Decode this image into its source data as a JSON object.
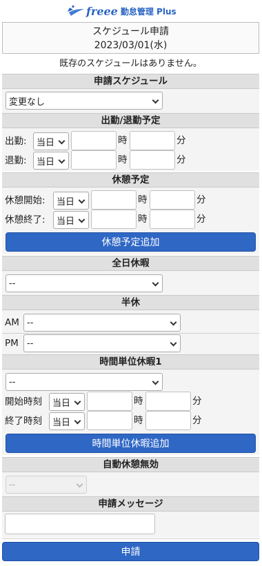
{
  "header": {
    "brand": "freee",
    "product": "勤怠管理 Plus",
    "title": "スケジュール申請",
    "date": "2023/03/01(水)"
  },
  "info": "既存のスケジュールはありません。",
  "schedule": {
    "heading": "申請スケジュール",
    "select_value": "変更なし"
  },
  "attendance": {
    "heading": "出勤/退勤予定",
    "rows": [
      {
        "label": "出勤:",
        "day": "当日",
        "hour_unit": "時",
        "min_unit": "分"
      },
      {
        "label": "退勤:",
        "day": "当日",
        "hour_unit": "時",
        "min_unit": "分"
      }
    ]
  },
  "break": {
    "heading": "休憩予定",
    "rows": [
      {
        "label": "休憩開始:",
        "day": "当日",
        "hour_unit": "時",
        "min_unit": "分"
      },
      {
        "label": "休憩終了:",
        "day": "当日",
        "hour_unit": "時",
        "min_unit": "分"
      }
    ],
    "add_button": "休憩予定追加"
  },
  "fullday": {
    "heading": "全日休暇",
    "select_value": "--"
  },
  "halfday": {
    "heading": "半休",
    "am_label": "AM",
    "am_value": "--",
    "pm_label": "PM",
    "pm_value": "--"
  },
  "hourly": {
    "heading": "時間単位休暇1",
    "select_value": "--",
    "rows": [
      {
        "label": "開始時刻",
        "day": "当日",
        "hour_unit": "時",
        "min_unit": "分"
      },
      {
        "label": "終了時刻",
        "day": "当日",
        "hour_unit": "時",
        "min_unit": "分"
      }
    ],
    "add_button": "時間単位休暇追加"
  },
  "autobreak": {
    "heading": "自動休憩無効",
    "select_value": "--"
  },
  "message": {
    "heading": "申請メッセージ",
    "value": ""
  },
  "submit_label": "申請"
}
